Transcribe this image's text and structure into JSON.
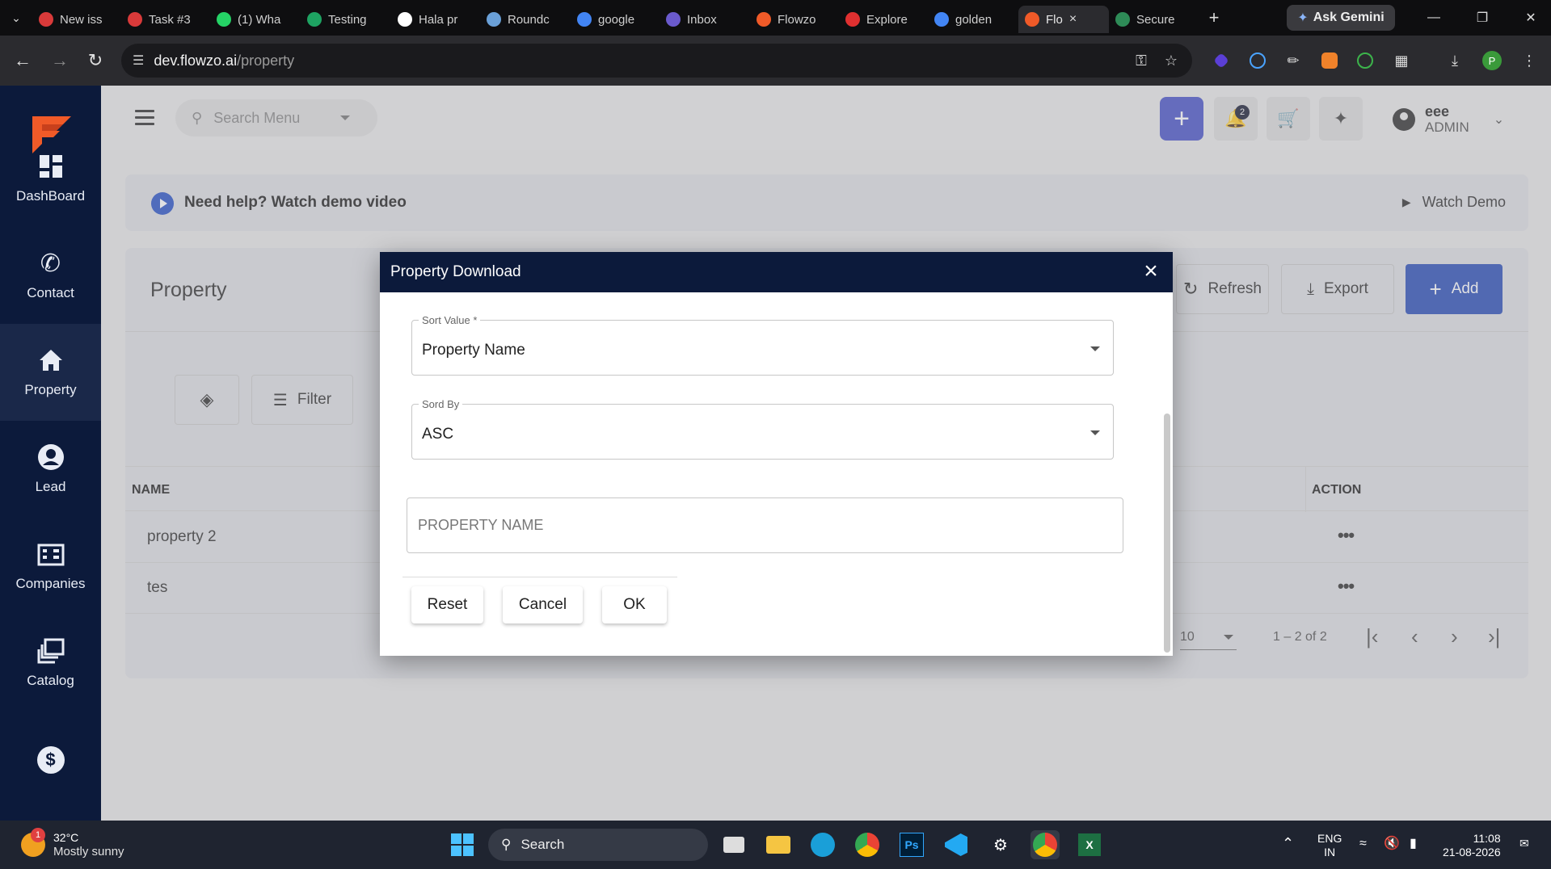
{
  "browser": {
    "tabs": [
      {
        "label": "New iss",
        "color": "#d93a3a"
      },
      {
        "label": "Task #3",
        "color": "#d93a3a"
      },
      {
        "label": "(1) Wha",
        "color": "#25d366"
      },
      {
        "label": "Testing",
        "color": "#1ea362"
      },
      {
        "label": "Hala pr",
        "color": "#ffffff"
      },
      {
        "label": "Roundc",
        "color": "#6aa0d8"
      },
      {
        "label": "google",
        "color": "#4285f4"
      },
      {
        "label": "Inbox",
        "color": "#6a5acd"
      },
      {
        "label": "Flowzo",
        "color": "#f05a28"
      },
      {
        "label": "Explore",
        "color": "#e03030"
      },
      {
        "label": "golden",
        "color": "#4285f4"
      },
      {
        "label": "Flo",
        "color": "#f05a28",
        "active": true
      },
      {
        "label": "Secure",
        "color": "#2e8b57"
      }
    ],
    "new_tab": "+",
    "gemini_label": "Ask Gemini",
    "url_host": "dev.flowzo.ai",
    "url_path": "/property",
    "profile_initial": "P"
  },
  "sidebar": {
    "items": [
      {
        "label": "DashBoard",
        "icon": "dashboard-icon"
      },
      {
        "label": "Contact",
        "icon": "phone-icon"
      },
      {
        "label": "Property",
        "icon": "home-icon",
        "active": true
      },
      {
        "label": "Lead",
        "icon": "account-circle-icon"
      },
      {
        "label": "Companies",
        "icon": "building-icon"
      },
      {
        "label": "Catalog",
        "icon": "catalog-icon"
      },
      {
        "label": "",
        "icon": "dollar-icon"
      }
    ]
  },
  "header": {
    "search_placeholder": "Search Menu",
    "notifications_count": "2",
    "user_name": "eee",
    "user_role": "ADMIN",
    "accent": "#4a55c9"
  },
  "help": {
    "text": "Need help? Watch demo video",
    "watch_label": "Watch Demo"
  },
  "page": {
    "title": "Property",
    "refresh_label": "Refresh",
    "export_label": "Export",
    "add_label": "Add",
    "filter_label": "Filter",
    "table": {
      "col_name": "NAME",
      "col_action": "ACTION",
      "rows": [
        "property 2",
        "tes"
      ]
    },
    "pagination": {
      "page_size": "10",
      "range": "1 – 2 of 2"
    }
  },
  "modal": {
    "title": "Property Download",
    "sort_value_label": "Sort Value *",
    "sort_value": "Property Name",
    "sort_by_label": "Sord By",
    "sort_by": "ASC",
    "name_placeholder": "PROPERTY NAME",
    "reset_label": "Reset",
    "cancel_label": "Cancel",
    "ok_label": "OK"
  },
  "taskbar": {
    "temperature": "32°C",
    "weather": "Mostly sunny",
    "weather_badge": "1",
    "search_label": "Search",
    "lang": "ENG",
    "region": "IN",
    "time": "11:08",
    "date": "21-08-2026"
  }
}
